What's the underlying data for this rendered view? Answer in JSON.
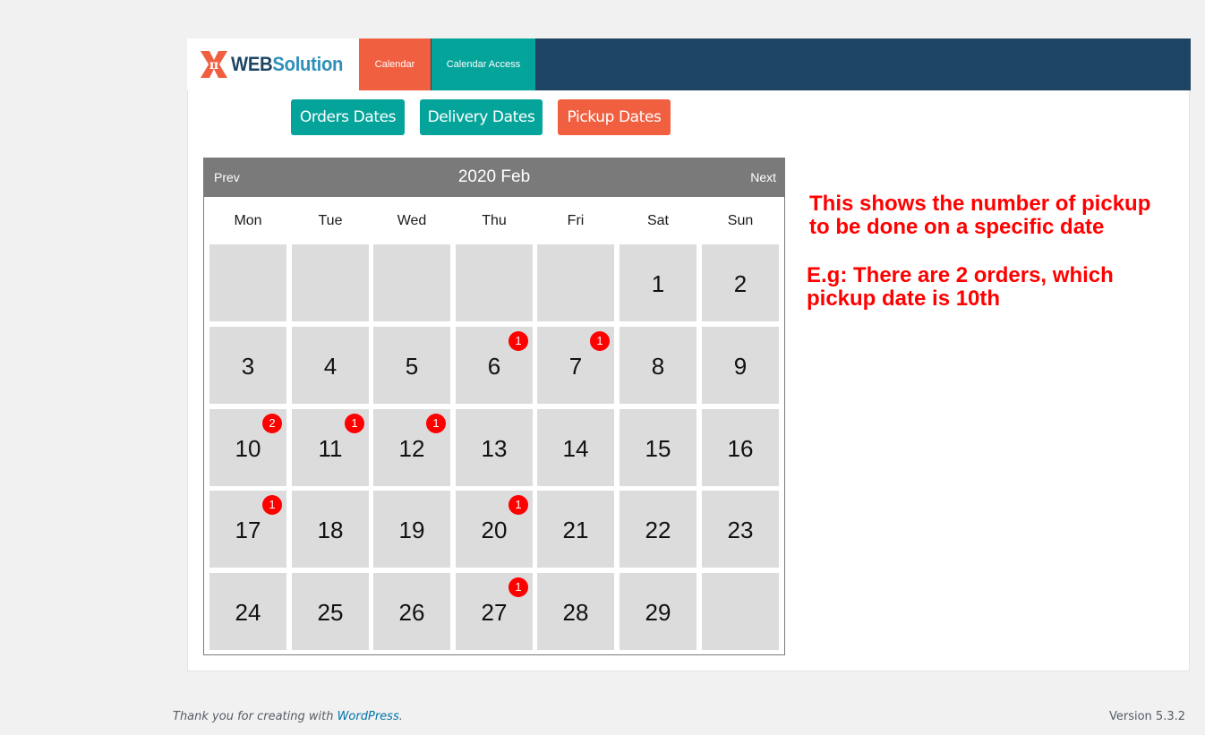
{
  "brand": {
    "name_part1": "WEB",
    "name_part2": "Solution",
    "icon": "pi-logo-icon",
    "color_primary": "#1d4563",
    "color_secondary": "#2f8fb9",
    "color_mark": "#f05f40"
  },
  "nav": {
    "tabs": [
      {
        "label": "Calendar",
        "active": true,
        "color": "#f05f40"
      },
      {
        "label": "Calendar Access",
        "active": false,
        "color": "#05a49b"
      }
    ]
  },
  "filters": {
    "orders_label": "Orders Dates",
    "delivery_label": "Delivery Dates",
    "pickup_label": "Pickup Dates",
    "active": "Pickup Dates"
  },
  "calendar": {
    "prev_label": "Prev",
    "next_label": "Next",
    "title": "2020 Feb",
    "weekdays": [
      "Mon",
      "Tue",
      "Wed",
      "Thu",
      "Fri",
      "Sat",
      "Sun"
    ],
    "weeks": [
      [
        {
          "day": ""
        },
        {
          "day": ""
        },
        {
          "day": ""
        },
        {
          "day": ""
        },
        {
          "day": ""
        },
        {
          "day": "1"
        },
        {
          "day": "2"
        }
      ],
      [
        {
          "day": "3"
        },
        {
          "day": "4"
        },
        {
          "day": "5"
        },
        {
          "day": "6",
          "count": "1"
        },
        {
          "day": "7",
          "count": "1"
        },
        {
          "day": "8"
        },
        {
          "day": "9"
        }
      ],
      [
        {
          "day": "10",
          "count": "2"
        },
        {
          "day": "11",
          "count": "1"
        },
        {
          "day": "12",
          "count": "1"
        },
        {
          "day": "13"
        },
        {
          "day": "14"
        },
        {
          "day": "15"
        },
        {
          "day": "16"
        }
      ],
      [
        {
          "day": "17",
          "count": "1"
        },
        {
          "day": "18"
        },
        {
          "day": "19"
        },
        {
          "day": "20",
          "count": "1"
        },
        {
          "day": "21"
        },
        {
          "day": "22"
        },
        {
          "day": "23"
        }
      ],
      [
        {
          "day": "24"
        },
        {
          "day": "25"
        },
        {
          "day": "26"
        },
        {
          "day": "27",
          "count": "1"
        },
        {
          "day": "28"
        },
        {
          "day": "29"
        },
        {
          "day": ""
        }
      ]
    ]
  },
  "annotations": {
    "line1a": "This shows the number of pickup",
    "line1b": "to be done on a specific date",
    "line2a": "E.g: There are 2 orders, which",
    "line2b": "pickup date is 10th"
  },
  "footer": {
    "thanks_prefix": "Thank you for creating with ",
    "thanks_link": "WordPress",
    "thanks_suffix": ".",
    "version": "Version 5.3.2"
  }
}
